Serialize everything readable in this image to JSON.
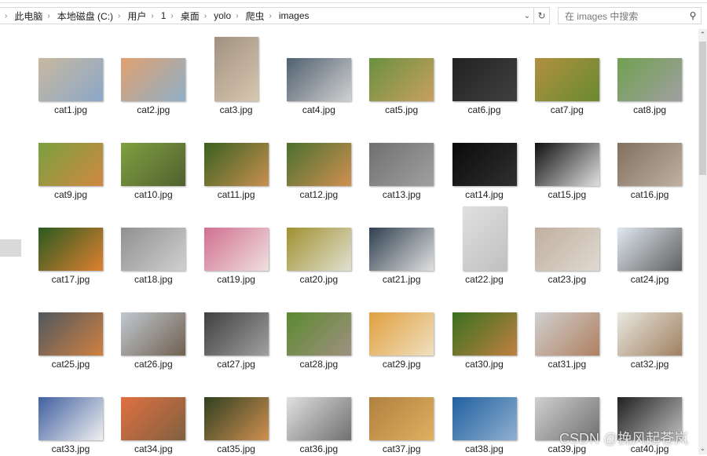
{
  "breadcrumb": [
    "此电脑",
    "本地磁盘 (C:)",
    "用户",
    "1",
    "桌面",
    "yolo",
    "爬虫",
    "images"
  ],
  "search": {
    "placeholder": "在 images 中搜索"
  },
  "icons": {
    "dropdown": "chevron-down-icon",
    "refresh": "refresh-icon",
    "search": "search-icon"
  },
  "watermark": "CSDN @挽风起苍岚",
  "files": [
    {
      "name": "cat1.jpg",
      "c1": "#c9b8a0",
      "c2": "#8aa8c8",
      "p": false
    },
    {
      "name": "cat2.jpg",
      "c1": "#e0a070",
      "c2": "#8fb0c8",
      "p": false
    },
    {
      "name": "cat3.jpg",
      "c1": "#a09080",
      "c2": "#d8c8b0",
      "p": true
    },
    {
      "name": "cat4.jpg",
      "c1": "#506070",
      "c2": "#d0d0d0",
      "p": false
    },
    {
      "name": "cat5.jpg",
      "c1": "#6a9040",
      "c2": "#c8a060",
      "p": false
    },
    {
      "name": "cat6.jpg",
      "c1": "#222222",
      "c2": "#404040",
      "p": false
    },
    {
      "name": "cat7.jpg",
      "c1": "#b09040",
      "c2": "#6a8a30",
      "p": false
    },
    {
      "name": "cat8.jpg",
      "c1": "#70a050",
      "c2": "#a0a0a0",
      "p": false
    },
    {
      "name": "cat9.jpg",
      "c1": "#7aa040",
      "c2": "#d08840",
      "p": false
    },
    {
      "name": "cat10.jpg",
      "c1": "#80a040",
      "c2": "#506030",
      "p": false
    },
    {
      "name": "cat11.jpg",
      "c1": "#3a6020",
      "c2": "#c89050",
      "p": false
    },
    {
      "name": "cat12.jpg",
      "c1": "#4a7030",
      "c2": "#d09050",
      "p": false
    },
    {
      "name": "cat13.jpg",
      "c1": "#707070",
      "c2": "#a0a0a0",
      "p": false
    },
    {
      "name": "cat14.jpg",
      "c1": "#0a0a0a",
      "c2": "#303030",
      "p": false
    },
    {
      "name": "cat15.jpg",
      "c1": "#101010",
      "c2": "#e0e0e0",
      "p": false
    },
    {
      "name": "cat16.jpg",
      "c1": "#807060",
      "c2": "#c0b0a0",
      "p": false
    },
    {
      "name": "cat17.jpg",
      "c1": "#2a5a20",
      "c2": "#e08030",
      "p": false
    },
    {
      "name": "cat18.jpg",
      "c1": "#909090",
      "c2": "#d0d0d0",
      "p": false
    },
    {
      "name": "cat19.jpg",
      "c1": "#d07090",
      "c2": "#f0e0e0",
      "p": false
    },
    {
      "name": "cat20.jpg",
      "c1": "#a09030",
      "c2": "#e0e0d0",
      "p": false
    },
    {
      "name": "cat21.jpg",
      "c1": "#304050",
      "c2": "#e0e0e0",
      "p": false
    },
    {
      "name": "cat22.jpg",
      "c1": "#e0e0e0",
      "c2": "#c0c0c0",
      "p": true
    },
    {
      "name": "cat23.jpg",
      "c1": "#c0b0a0",
      "c2": "#e0d8d0",
      "p": false
    },
    {
      "name": "cat24.jpg",
      "c1": "#e0e8f0",
      "c2": "#606060",
      "p": false
    },
    {
      "name": "cat25.jpg",
      "c1": "#505860",
      "c2": "#d08040",
      "p": false
    },
    {
      "name": "cat26.jpg",
      "c1": "#c0c8d0",
      "c2": "#706050",
      "p": false
    },
    {
      "name": "cat27.jpg",
      "c1": "#404040",
      "c2": "#a0a0a0",
      "p": false
    },
    {
      "name": "cat28.jpg",
      "c1": "#5a8a30",
      "c2": "#a09080",
      "p": false
    },
    {
      "name": "cat29.jpg",
      "c1": "#e0a040",
      "c2": "#f0e0c0",
      "p": false
    },
    {
      "name": "cat30.jpg",
      "c1": "#3a7020",
      "c2": "#c08040",
      "p": false
    },
    {
      "name": "cat31.jpg",
      "c1": "#d0d0d0",
      "c2": "#b08060",
      "p": false
    },
    {
      "name": "cat32.jpg",
      "c1": "#e8e8e0",
      "c2": "#a08060",
      "p": false
    },
    {
      "name": "cat33.jpg",
      "c1": "#4060a0",
      "c2": "#f0f0f0",
      "p": false
    },
    {
      "name": "cat34.jpg",
      "c1": "#e07040",
      "c2": "#806040",
      "p": false
    },
    {
      "name": "cat35.jpg",
      "c1": "#304020",
      "c2": "#d09050",
      "p": false
    },
    {
      "name": "cat36.jpg",
      "c1": "#e0e0e0",
      "c2": "#707070",
      "p": false
    },
    {
      "name": "cat37.jpg",
      "c1": "#b08040",
      "c2": "#e0b060",
      "p": false
    },
    {
      "name": "cat38.jpg",
      "c1": "#2060a0",
      "c2": "#90b0d0",
      "p": false
    },
    {
      "name": "cat39.jpg",
      "c1": "#d0d0d0",
      "c2": "#707070",
      "p": false
    },
    {
      "name": "cat40.jpg",
      "c1": "#202020",
      "c2": "#c0c0c0",
      "p": false
    }
  ]
}
